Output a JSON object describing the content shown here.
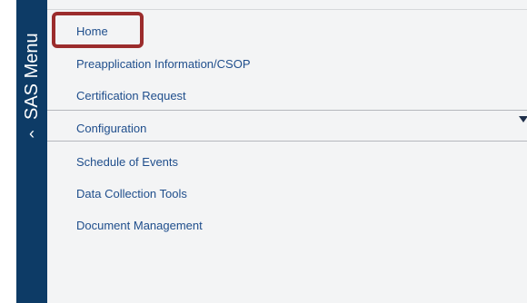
{
  "sidebar": {
    "title": "SAS Menu",
    "collapse_icon": "chevron-left-icon"
  },
  "menu": {
    "home": "Home",
    "preapplication": "Preapplication Information/CSOP",
    "certification": "Certification Request",
    "configuration": "Configuration",
    "schedule": "Schedule of Events",
    "data_collection": "Data Collection Tools",
    "document_management": "Document Management"
  },
  "colors": {
    "sidebar_bg": "#0d3b66",
    "link": "#1f4e8c",
    "highlight": "#9b2c2c"
  }
}
